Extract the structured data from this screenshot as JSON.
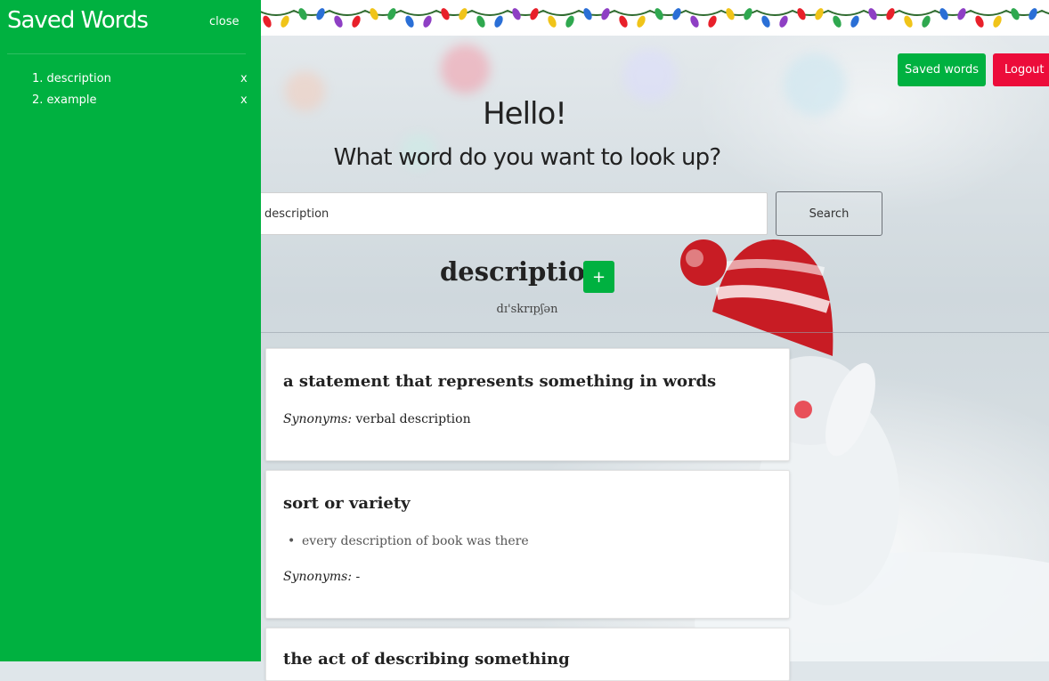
{
  "header": {
    "saved_words_button": "Saved words",
    "logout_button": "Logout"
  },
  "hero": {
    "greeting": "Hello!",
    "question": "What word do you want to look up?"
  },
  "search": {
    "value": "description",
    "button_label": "Search"
  },
  "result": {
    "word": "description",
    "add_label": "+",
    "phonetic": "dɪ'skrɪpʃən"
  },
  "definitions": [
    {
      "definition": "a statement that represents something in words",
      "synonyms_label": "Synonyms:",
      "synonyms": "verbal description"
    },
    {
      "definition": "sort or variety",
      "example": "every description of book was there",
      "synonyms_label": "Synonyms:",
      "synonyms": "-"
    },
    {
      "definition": "the act of describing something"
    }
  ],
  "sidebar": {
    "title": "Saved Words",
    "close_label": "close",
    "items": [
      {
        "label": "1. description",
        "remove": "x"
      },
      {
        "label": "2. example",
        "remove": "x"
      }
    ]
  },
  "colors": {
    "sidebar": "#00b140",
    "saved_button": "#00b140",
    "logout_button": "#ec0c3a",
    "add_button": "#00b140"
  },
  "icons": [
    "christmas-lights-garland",
    "snowman-decoration"
  ]
}
